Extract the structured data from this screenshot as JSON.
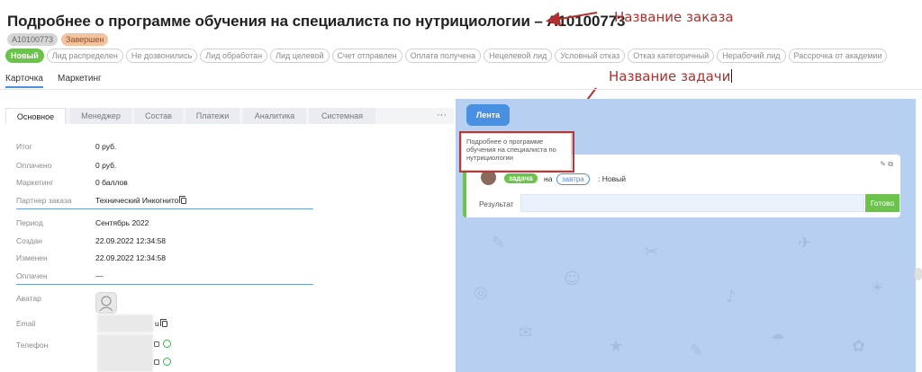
{
  "header": {
    "title": "Подробнее о программе обучения на специалиста по нутрициологии – A10100773",
    "order_id_badge": "A10100773",
    "status_badge": "Завершен"
  },
  "annotations": {
    "order_name": "Название заказа",
    "task_name": "Название задачи"
  },
  "stages": [
    "Новый",
    "Лид распределен",
    "Не дозвонились",
    "Лид обработан",
    "Лид целевой",
    "Счет отправлен",
    "Оплата получена",
    "Нецелевой лид",
    "Условный отказ",
    "Отказ категоричный",
    "Нерабочий лид",
    "Рассрочка от академии"
  ],
  "top_tabs": [
    "Карточка",
    "Маркетинг"
  ],
  "inner_tabs": [
    "Основное",
    "Менеджер",
    "Состав",
    "Платежи",
    "Аналитика",
    "Системная"
  ],
  "more_label": "···",
  "fields": {
    "total": {
      "label": "Итог",
      "value": "0 руб."
    },
    "paid": {
      "label": "Оплачено",
      "value": "0 руб."
    },
    "marketing": {
      "label": "Маркетинг",
      "value": "0 баллов"
    },
    "partner": {
      "label": "Партнер заказа",
      "value": "Технический Инкогнито"
    },
    "period": {
      "label": "Период",
      "value": "Сентябрь 2022"
    },
    "created": {
      "label": "Создан",
      "value": "22.09.2022 12:34:58"
    },
    "changed": {
      "label": "Изменен",
      "value": "22.09.2022 12:34:58"
    },
    "paid_at": {
      "label": "Оплачен",
      "value": "—"
    },
    "avatar": {
      "label": "Аватар"
    },
    "email": {
      "label": "Email",
      "value_suffix": "u"
    },
    "phone": {
      "label": "Телефон"
    }
  },
  "feed": {
    "button": "Лента",
    "tooltip": "Подробнее о программе обучения на специалиста по нутрициологии",
    "task_chip": "задача",
    "on_label": "на",
    "when_chip": "завтра",
    "status_text": ": Новый",
    "result_label": "Результат",
    "done_button": "Готово"
  },
  "colors": {
    "accent_blue": "#4a90e2",
    "green": "#6cc34b",
    "annotation_red": "#b03030",
    "feed_bg": "#b7cff0"
  }
}
